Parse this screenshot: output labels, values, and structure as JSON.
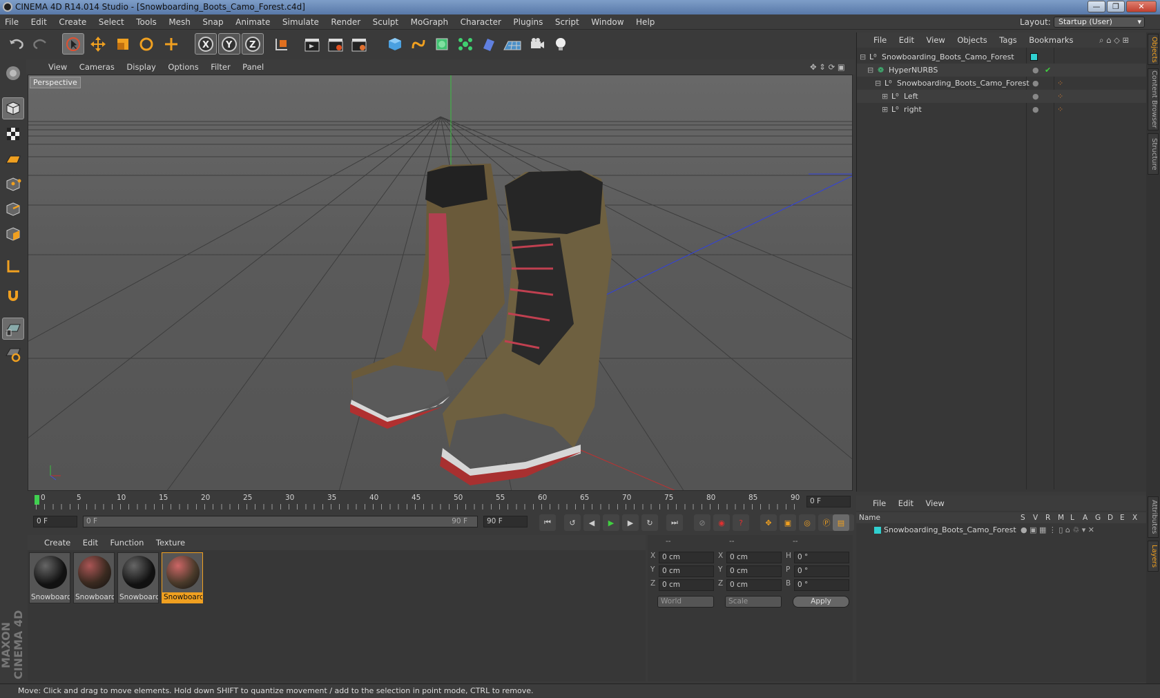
{
  "window": {
    "title": "CINEMA 4D R14.014 Studio - [Snowboarding_Boots_Camo_Forest.c4d]",
    "minimize": "—",
    "maximize": "❐",
    "close": "✕"
  },
  "menu": [
    "File",
    "Edit",
    "Create",
    "Select",
    "Tools",
    "Mesh",
    "Snap",
    "Animate",
    "Simulate",
    "Render",
    "Sculpt",
    "MoGraph",
    "Character",
    "Plugins",
    "Script",
    "Window",
    "Help"
  ],
  "layout": {
    "label": "Layout:",
    "value": "Startup (User)"
  },
  "viewport": {
    "menu": [
      "View",
      "Cameras",
      "Display",
      "Options",
      "Filter",
      "Panel"
    ],
    "label": "Perspective"
  },
  "objects": {
    "menu": [
      "File",
      "Edit",
      "View",
      "Objects",
      "Tags",
      "Bookmarks"
    ],
    "rows": [
      {
        "name": "Snowboarding_Boots_Camo_Forest"
      },
      {
        "name": "HyperNURBS"
      },
      {
        "name": "Snowboarding_Boots_Camo_Forest"
      },
      {
        "name": "Left"
      },
      {
        "name": "right"
      }
    ]
  },
  "sidetabs": [
    "Objects",
    "Content Browser",
    "Structure",
    "Attributes",
    "Layers"
  ],
  "timeline": {
    "ticks": [
      "0",
      "5",
      "10",
      "15",
      "20",
      "25",
      "30",
      "35",
      "40",
      "45",
      "50",
      "55",
      "60",
      "65",
      "70",
      "75",
      "80",
      "85",
      "90"
    ],
    "current": "0 F"
  },
  "controls": {
    "start": "0 F",
    "range_start": "0 F",
    "range_end": "90 F",
    "end": "90 F"
  },
  "materials": {
    "menu": [
      "Create",
      "Edit",
      "Function",
      "Texture"
    ],
    "items": [
      "Snowboard",
      "Snowboard",
      "Snowboard",
      "Snowboard"
    ]
  },
  "coords": {
    "headers": [
      "--",
      "--",
      "--"
    ],
    "rows": [
      {
        "a": "X",
        "av": "0 cm",
        "b": "X",
        "bv": "0 cm",
        "c": "H",
        "cv": "0 °"
      },
      {
        "a": "Y",
        "av": "0 cm",
        "b": "Y",
        "bv": "0 cm",
        "c": "P",
        "cv": "0 °"
      },
      {
        "a": "Z",
        "av": "0 cm",
        "b": "Z",
        "bv": "0 cm",
        "c": "B",
        "cv": "0 °"
      }
    ],
    "world": "World",
    "scale": "Scale",
    "apply": "Apply"
  },
  "layers": {
    "menu": [
      "File",
      "Edit",
      "View"
    ],
    "name_header": "Name",
    "cols": [
      "S",
      "V",
      "R",
      "M",
      "L",
      "A",
      "G",
      "D",
      "E",
      "X"
    ],
    "row": "Snowboarding_Boots_Camo_Forest"
  },
  "status": "Move: Click and drag to move elements. Hold down SHIFT to quantize movement / add to the selection in point mode, CTRL to remove.",
  "brand": "MAXON CINEMA 4D",
  "colors": {
    "accent": "#f0a020",
    "selected_mat": "#f0a020",
    "layer_color": "#30d0d0"
  }
}
